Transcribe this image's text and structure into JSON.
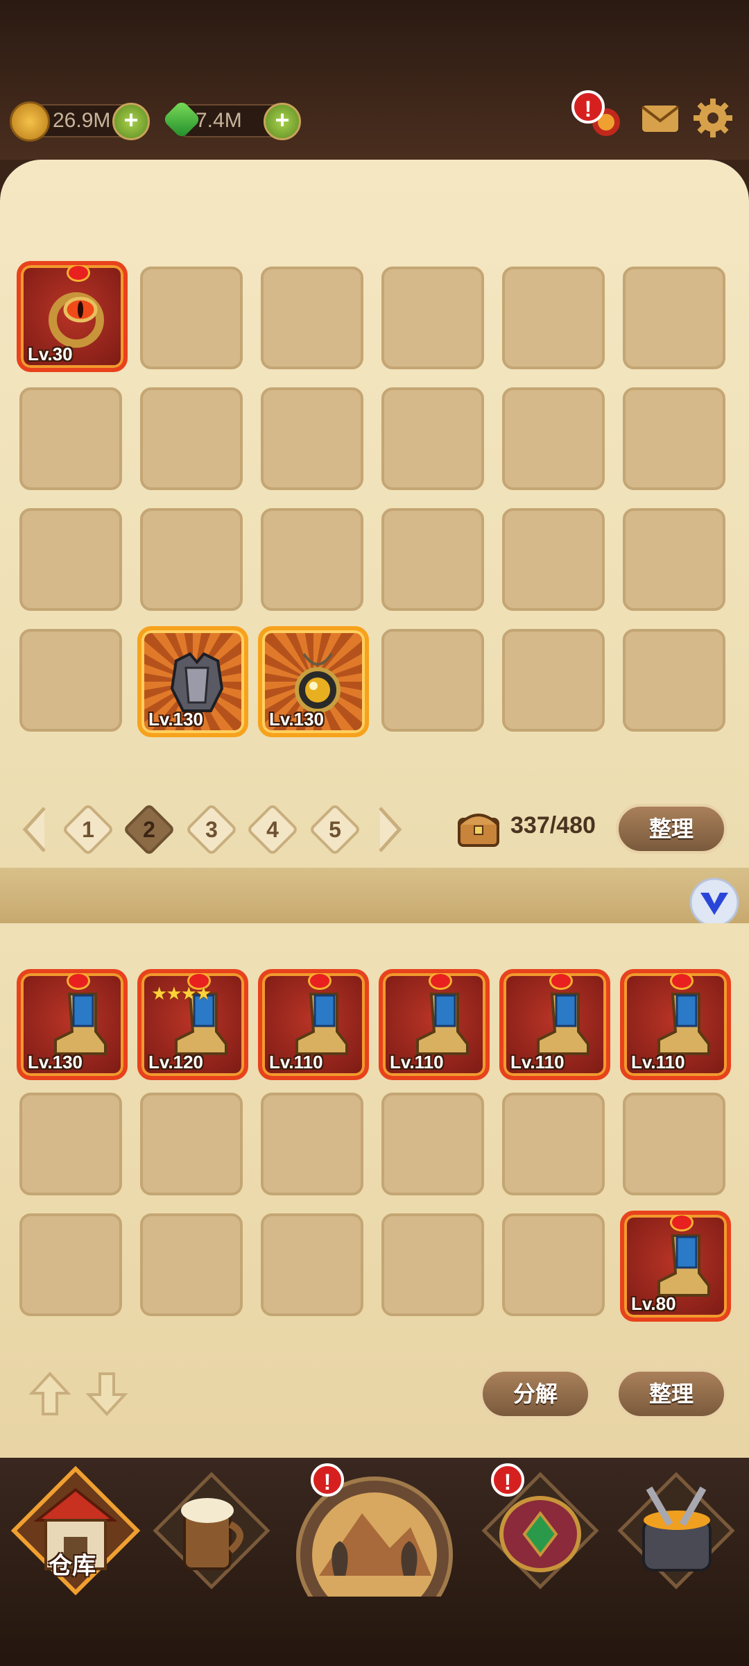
{
  "resources": {
    "gold": "26.9M",
    "gems": "7.4M"
  },
  "top_icons": [
    "event-alert-icon",
    "mail-icon",
    "settings-gear-icon"
  ],
  "alert_badge": "!",
  "storage": {
    "items": [
      {
        "name": "ring-of-eye",
        "level": "Lv.30",
        "rarity": "red"
      },
      {
        "name": "plate-armor",
        "level": "Lv.130",
        "rarity": "orange"
      },
      {
        "name": "eye-amulet",
        "level": "Lv.130",
        "rarity": "orange"
      }
    ],
    "pages": [
      "1",
      "2",
      "3",
      "4",
      "5"
    ],
    "active_page": "2",
    "capacity": "337/480",
    "sort_label": "整理"
  },
  "inventory": {
    "items": [
      {
        "name": "boots",
        "level": "Lv.130",
        "stars": ""
      },
      {
        "name": "boots",
        "level": "Lv.120",
        "stars": "★★★★"
      },
      {
        "name": "boots",
        "level": "Lv.110",
        "stars": ""
      },
      {
        "name": "boots",
        "level": "Lv.110",
        "stars": ""
      },
      {
        "name": "boots",
        "level": "Lv.110",
        "stars": ""
      },
      {
        "name": "boots",
        "level": "Lv.110",
        "stars": ""
      },
      {
        "name": "boots",
        "level": "Lv.80",
        "stars": ""
      }
    ],
    "dismantle_label": "分解",
    "sort_label": "整理"
  },
  "bottom_nav": {
    "warehouse_label": "仓库",
    "items": [
      "warehouse-icon",
      "tavern-icon",
      "adventure-icon",
      "treasure-icon",
      "forge-icon"
    ]
  },
  "colors": {
    "parchment": "#efdfb4",
    "slot": "#d5b98a",
    "rarity_red": "#e8421c",
    "rarity_orange": "#f7a21c"
  }
}
